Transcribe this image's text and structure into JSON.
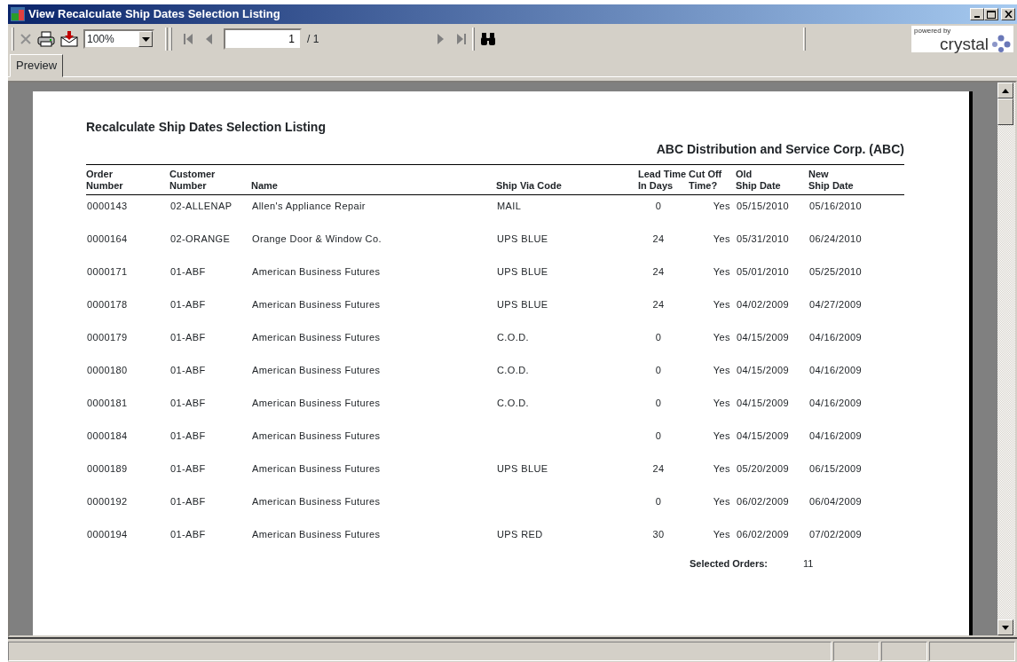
{
  "window": {
    "title": "View Recalculate Ship Dates Selection Listing"
  },
  "toolbar": {
    "zoom": "100%",
    "page": "1",
    "page_total": "/ 1",
    "logo_top": "powered by",
    "logo_main": "crystal"
  },
  "tabs": [
    {
      "label": "Preview",
      "selected": true
    }
  ],
  "report": {
    "title": "Recalculate Ship Dates Selection Listing",
    "company": "ABC Distribution and Service Corp. (ABC)",
    "columns": [
      "Order\nNumber",
      "Customer\nNumber",
      "Name",
      "Ship Via Code",
      "Lead Time\nIn Days",
      "Cut Off\nTime?",
      "Old\nShip Date",
      "New\nShip Date"
    ],
    "rows": [
      [
        "0000143",
        "02-ALLENAP",
        "Allen's Appliance Repair",
        "MAIL",
        "0",
        "Yes",
        "05/15/2010",
        "05/16/2010"
      ],
      [
        "0000164",
        "02-ORANGE",
        "Orange Door & Window Co.",
        "UPS BLUE",
        "24",
        "Yes",
        "05/31/2010",
        "06/24/2010"
      ],
      [
        "0000171",
        "01-ABF",
        "American Business Futures",
        "UPS BLUE",
        "24",
        "Yes",
        "05/01/2010",
        "05/25/2010"
      ],
      [
        "0000178",
        "01-ABF",
        "American Business Futures",
        "UPS BLUE",
        "24",
        "Yes",
        "04/02/2009",
        "04/27/2009"
      ],
      [
        "0000179",
        "01-ABF",
        "American Business Futures",
        "C.O.D.",
        "0",
        "Yes",
        "04/15/2009",
        "04/16/2009"
      ],
      [
        "0000180",
        "01-ABF",
        "American Business Futures",
        "C.O.D.",
        "0",
        "Yes",
        "04/15/2009",
        "04/16/2009"
      ],
      [
        "0000181",
        "01-ABF",
        "American Business Futures",
        "C.O.D.",
        "0",
        "Yes",
        "04/15/2009",
        "04/16/2009"
      ],
      [
        "0000184",
        "01-ABF",
        "American Business Futures",
        "",
        "0",
        "Yes",
        "04/15/2009",
        "04/16/2009"
      ],
      [
        "0000189",
        "01-ABF",
        "American Business Futures",
        "UPS BLUE",
        "24",
        "Yes",
        "05/20/2009",
        "06/15/2009"
      ],
      [
        "0000192",
        "01-ABF",
        "American Business Futures",
        "",
        "0",
        "Yes",
        "06/02/2009",
        "06/04/2009"
      ],
      [
        "0000194",
        "01-ABF",
        "American Business Futures",
        "UPS RED",
        "30",
        "Yes",
        "06/02/2009",
        "07/02/2009"
      ]
    ],
    "summary_label": "Selected Orders:",
    "summary_value": "11"
  }
}
